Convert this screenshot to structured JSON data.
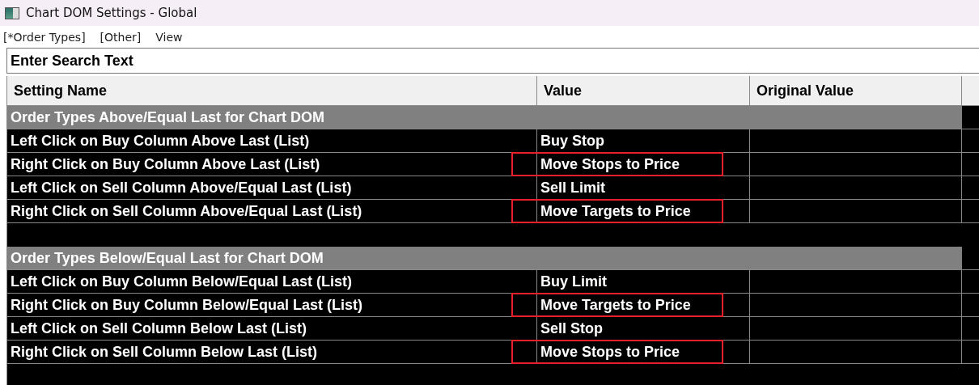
{
  "window": {
    "title": "Chart DOM Settings - Global"
  },
  "menu": [
    {
      "label": "[*Order Types]"
    },
    {
      "label": "[Other]"
    },
    {
      "label": "View"
    }
  ],
  "search": {
    "placeholder": "Enter Search Text"
  },
  "table": {
    "columns": [
      "Setting Name",
      "Value",
      "Original Value"
    ],
    "sections": [
      {
        "title": "Order Types Above/Equal Last for Chart DOM",
        "rows": [
          {
            "name": "Left Click on Buy Column Above Last (List)",
            "value": "Buy Stop",
            "highlighted": false
          },
          {
            "name": "Right Click on Buy Column Above Last (List)",
            "value": "Move Stops to Price",
            "highlighted": true
          },
          {
            "name": "Left Click on Sell Column Above/Equal Last (List)",
            "value": "Sell Limit",
            "highlighted": false
          },
          {
            "name": "Right Click on Sell Column Above/Equal Last (List)",
            "value": "Move Targets to Price",
            "highlighted": true
          }
        ]
      },
      {
        "title": "Order Types Below/Equal Last for Chart DOM",
        "rows": [
          {
            "name": "Left Click on Buy Column Below/Equal Last (List)",
            "value": "Buy Limit",
            "highlighted": false
          },
          {
            "name": "Right Click on Buy Column Below/Equal Last (List)",
            "value": "Move Targets to Price",
            "highlighted": true
          },
          {
            "name": "Left Click on Sell Column Below Last (List)",
            "value": "Sell Stop",
            "highlighted": false
          },
          {
            "name": "Right Click on Sell Column Below Last (List)",
            "value": "Move Stops to Price",
            "highlighted": true
          }
        ]
      }
    ]
  }
}
